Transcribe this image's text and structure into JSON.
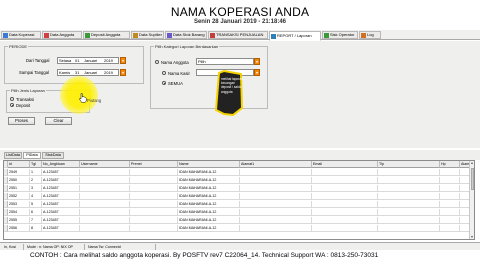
{
  "header": {
    "title": "NAMA KOPERASI ANDA",
    "date": "Senin 28 Januari 2019 - 21:18:46"
  },
  "toolbar": {
    "tabs": [
      {
        "label": "Data Koperasi",
        "icon": "building-icon",
        "color": "#3b7bd4"
      },
      {
        "label": "Data Anggota",
        "icon": "users-icon",
        "color": "#d04040"
      },
      {
        "label": "Deposit Anggota",
        "icon": "deposit-icon",
        "color": "#3a9a3a"
      },
      {
        "label": "Data Supllier",
        "icon": "supplier-icon",
        "color": "#c08a20"
      },
      {
        "label": "Data Stok Barang",
        "icon": "stock-icon",
        "color": "#6a5acd"
      },
      {
        "label": "TRANSAKSI PENJUALAN",
        "icon": "cart-icon",
        "color": "#c04040"
      },
      {
        "label": "REPORT / Laporan",
        "icon": "report-icon",
        "color": "#2c7fb8"
      },
      {
        "label": "Sisk Operator",
        "icon": "operator-icon",
        "color": "#3a9a3a"
      },
      {
        "label": "Log",
        "icon": "log-icon",
        "color": "#d07020"
      }
    ],
    "active_index": 6
  },
  "periode": {
    "legend": "PERIODE",
    "dari_label": "Dari Tanggal",
    "dari_day": "Selasa",
    "dari_date": "01",
    "dari_month": "Januari",
    "dari_year": "2019",
    "sampai_label": "Sampai Tanggal",
    "sampai_day": "Kamis",
    "sampai_date": "31",
    "sampai_month": "Januari",
    "sampai_year": "2019"
  },
  "jenis": {
    "legend": "Pilih Jenis Laporan",
    "options": [
      {
        "label": "Transaksi",
        "selected": false
      },
      {
        "label": "Deposit",
        "selected": true
      }
    ],
    "hover_text": "Piutang"
  },
  "kategori": {
    "legend": "Pilih Kategori Laporan Berdasarkan",
    "options": [
      {
        "label": "Nama Anggota",
        "selected": false
      },
      {
        "label": "Nama Kasir",
        "selected": false
      },
      {
        "label": "SEMUA",
        "selected": true
      }
    ],
    "nama_value": "Pilih"
  },
  "buttons": {
    "proses": "Proses",
    "clear": "Clear"
  },
  "annotation": {
    "text": "melihat laporan keuangan deposit / saldo anggota"
  },
  "grid_tabs": {
    "tabs": [
      "ListData",
      "PiData",
      "StokData"
    ],
    "active_index": 1
  },
  "grid": {
    "columns": [
      "id",
      "Tgl",
      "No_Angktuan",
      "Username",
      "Prenet",
      "Name",
      "Alamat1",
      "Email",
      "Tlp",
      "Hp",
      "Alamat2"
    ],
    "rows": [
      [
        "2549",
        "1",
        "A-123457",
        "",
        "",
        "IDAN MAHARANI-A-12",
        "",
        "",
        "",
        "",
        ""
      ],
      [
        "2550",
        "2",
        "A-123457",
        "",
        "",
        "IDAN MAHARANI-A-12",
        "",
        "",
        "",
        "",
        ""
      ],
      [
        "2551",
        "3",
        "A-123457",
        "",
        "",
        "IDAN MAHARANI-A-12",
        "",
        "",
        "",
        "",
        ""
      ],
      [
        "2552",
        "4",
        "A-123457",
        "",
        "",
        "IDAN MAHARANI-A-12",
        "",
        "",
        "",
        "",
        ""
      ],
      [
        "2553",
        "5",
        "A-123457",
        "",
        "",
        "IDAN MAHARANI-A-12",
        "",
        "",
        "",
        "",
        ""
      ],
      [
        "2554",
        "6",
        "A-123457",
        "",
        "",
        "IDAN MAHARANI-A-12",
        "",
        "",
        "",
        "",
        ""
      ],
      [
        "2555",
        "7",
        "A-123457",
        "",
        "",
        "IDAN MAHARANI-A-12",
        "",
        "",
        "",
        "",
        ""
      ],
      [
        "2556",
        "8",
        "A-123457",
        "",
        "",
        "IDAN MAHARANI-A-12",
        "",
        "",
        "",
        "",
        ""
      ]
    ]
  },
  "statusbar": {
    "panels": [
      "In, Kosi",
      "Mode : n: Nama OP: NIX OP",
      "Nama Tsr: Connectd"
    ]
  },
  "caption": "CONTOH : Cara melihat saldo anggota koperasi. By POSFTV rev7 C22064_14. Technical Support WA : 0813-250-73031"
}
